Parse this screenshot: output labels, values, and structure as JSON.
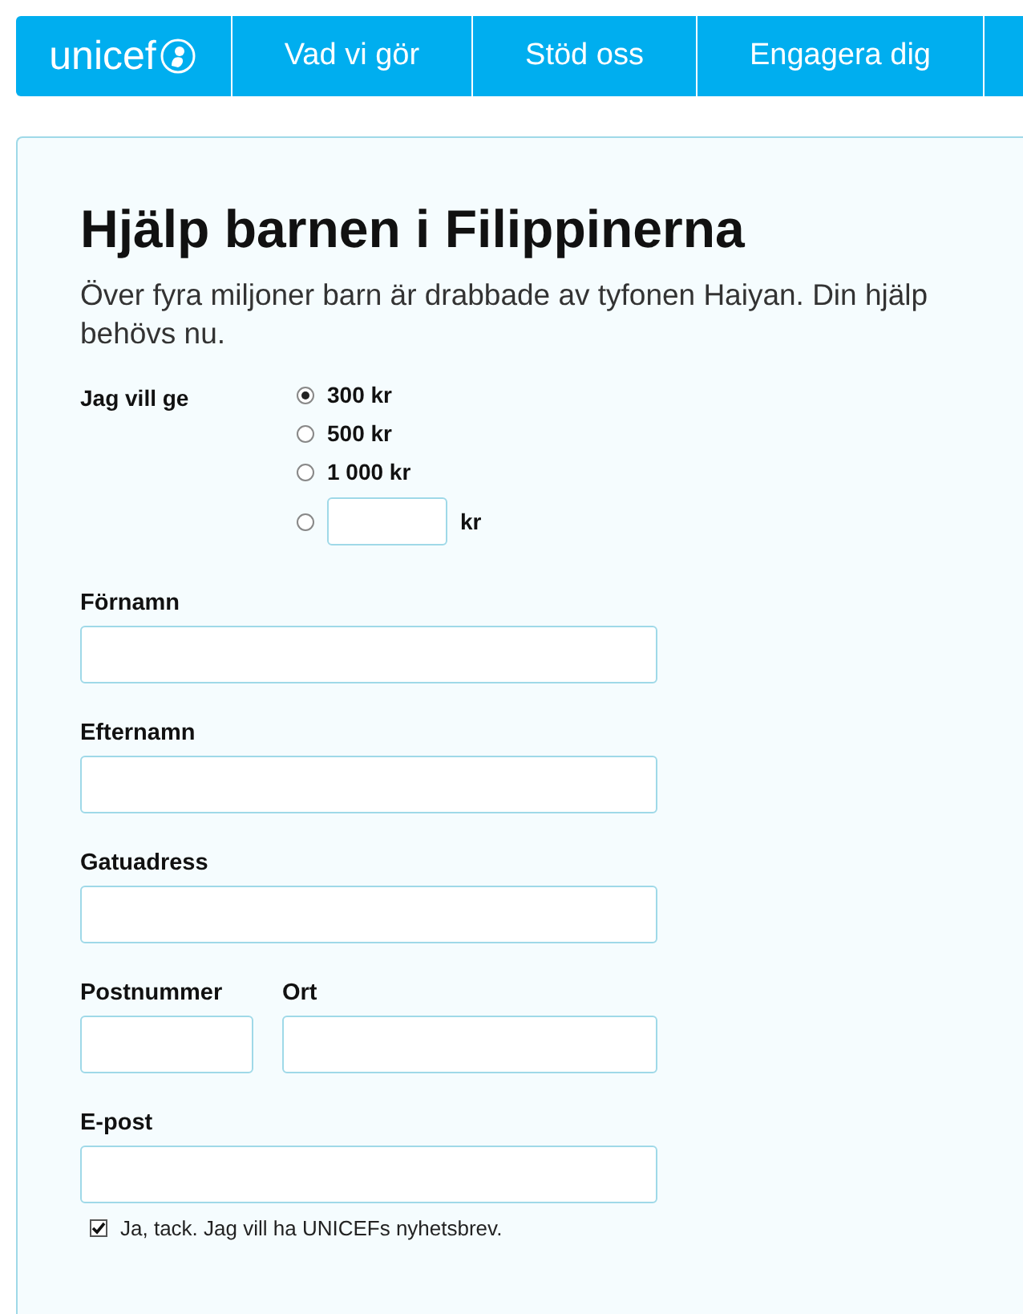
{
  "nav": {
    "logo": "unicef",
    "items": [
      {
        "label": "Vad vi gör"
      },
      {
        "label": "Stöd oss"
      },
      {
        "label": "Engagera dig"
      }
    ]
  },
  "heading": "Hjälp barnen i Filippinerna",
  "intro": "Över fyra miljoner barn är drabbade av tyfonen Haiyan. Din hjälp behövs nu.",
  "amount": {
    "label": "Jag vill ge",
    "options": [
      {
        "kind": "fixed",
        "label": "300 kr",
        "selected": true
      },
      {
        "kind": "fixed",
        "label": "500 kr",
        "selected": false
      },
      {
        "kind": "fixed",
        "label": "1 000 kr",
        "selected": false
      },
      {
        "kind": "custom",
        "unit": "kr",
        "selected": false
      }
    ]
  },
  "field_rows": [
    [
      {
        "label": "Förnamn",
        "kind": "wide"
      }
    ],
    [
      {
        "label": "Efternamn",
        "kind": "wide"
      }
    ],
    [
      {
        "label": "Gatuadress",
        "kind": "wide"
      }
    ],
    [
      {
        "label": "Postnummer",
        "kind": "short"
      },
      {
        "label": "Ort",
        "kind": "medium"
      }
    ],
    [
      {
        "label": "E-post",
        "kind": "wide"
      }
    ]
  ],
  "newsletter": {
    "label": "Ja, tack. Jag vill ha UNICEFs nyhetsbrev.",
    "checked": true
  }
}
